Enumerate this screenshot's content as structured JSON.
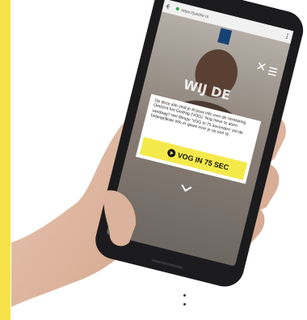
{
  "browser": {
    "url": "https://justitie.nl"
  },
  "hero": {
    "overlay_text": "WIJ DE"
  },
  "popup": {
    "message": "Op deze site vind je al jouw info over de Verklaring Omtrent het Gedrag (VOG). Nog meer te doen vandaag? Het filmpje 'VOG in 75 seconden' zet de belangrijkste info er gauw voor je op een rij.",
    "cta_label": "VOG IN 75 SEC"
  },
  "colors": {
    "accent_yellow": "#f7e24a",
    "button_yellow": "#f4e94a",
    "phone_body": "#1b1b1d"
  },
  "icons": [
    "back-arrow-icon",
    "lock-icon",
    "menu-icon",
    "close-icon",
    "logo-emblem",
    "play-icon",
    "chevron-down-icon"
  ]
}
